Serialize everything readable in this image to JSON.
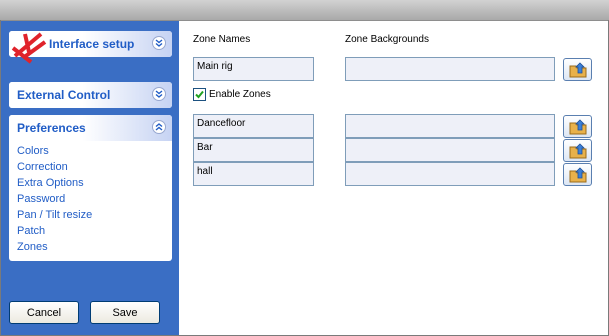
{
  "sidebar": {
    "panels": {
      "interface_setup": {
        "title": "Interface setup",
        "icon": "logo-icon",
        "expand_icon": "chevron-double-down-icon"
      },
      "external_control": {
        "title": "External Control",
        "expand_icon": "chevron-double-down-icon"
      },
      "preferences": {
        "title": "Preferences",
        "collapse_icon": "chevron-double-up-icon",
        "items": [
          "Colors",
          "Correction",
          "Extra Options",
          "Password",
          "Pan / Tilt resize",
          "Patch",
          "Zones"
        ]
      }
    },
    "buttons": {
      "cancel": "Cancel",
      "save": "Save"
    }
  },
  "main": {
    "headers": {
      "zone_names": "Zone Names",
      "zone_backgrounds": "Zone Backgrounds"
    },
    "main_zone": {
      "name": "Main rig",
      "background": ""
    },
    "enable_zones": {
      "label": "Enable Zones",
      "checked": true
    },
    "zones": [
      {
        "name": "Dancefloor",
        "background": ""
      },
      {
        "name": "Bar",
        "background": ""
      },
      {
        "name": "hall",
        "background": ""
      }
    ],
    "browse_icon": "folder-upload-icon"
  },
  "colors": {
    "sidebar_bg": "#3a6ec4",
    "link": "#215dc6",
    "field_bg": "#eef0f8",
    "field_border": "#7f9db9"
  }
}
